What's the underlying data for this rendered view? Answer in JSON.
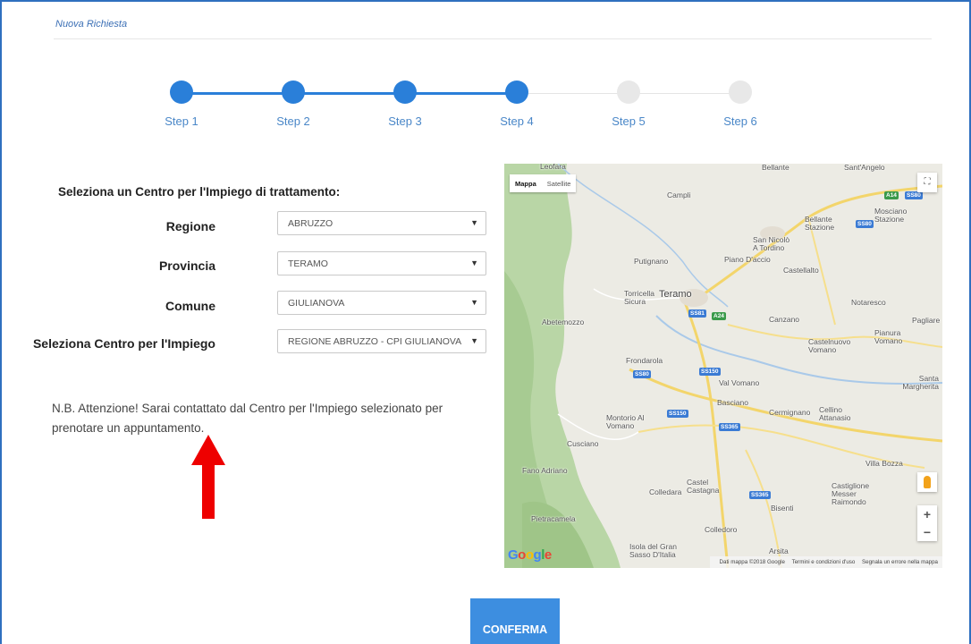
{
  "breadcrumb": "Nuova Richiesta",
  "stepper": {
    "steps": [
      {
        "label": "Step 1",
        "state": "completed"
      },
      {
        "label": "Step 2",
        "state": "completed"
      },
      {
        "label": "Step 3",
        "state": "completed"
      },
      {
        "label": "Step 4",
        "state": "current"
      },
      {
        "label": "Step 5",
        "state": "pending"
      },
      {
        "label": "Step 6",
        "state": "pending"
      }
    ],
    "colors": {
      "active": "#2a7fd9",
      "inactive": "#e8e8e8"
    }
  },
  "form": {
    "title": "Seleziona un Centro per l'Impiego di trattamento:",
    "fields": [
      {
        "label": "Regione",
        "value": "ABRUZZO"
      },
      {
        "label": "Provincia",
        "value": "TERAMO"
      },
      {
        "label": "Comune",
        "value": "GIULIANOVA"
      },
      {
        "label": "Seleziona Centro per l'Impiego",
        "value": "REGIONE ABRUZZO - CPI GIULIANOVA"
      }
    ]
  },
  "note": "N.B. Attenzione! Sarai contattato dal Centro per l'Impiego selezionato per prenotare un appuntamento.",
  "map": {
    "type_control": {
      "map": "Mappa",
      "satellite": "Satellite",
      "selected": "Mappa"
    },
    "places": [
      "Leofara",
      "Bellante",
      "Sant'Angelo",
      "Campli",
      "Bellante Stazione",
      "Mosciano Stazione",
      "San Nicolò A Tordino",
      "Putignano",
      "Piano D'accio",
      "Castellalto",
      "Torricella Sicura",
      "Teramo",
      "Notaresco",
      "Abetemozzo",
      "Canzano",
      "Pianura Vomano",
      "Pagliare",
      "Castelnuovo Vomano",
      "Frondarola",
      "Val Vomano",
      "Santa Margherita",
      "Basciano",
      "Cermignano",
      "Cellino Attanasio",
      "Montorio Al Vomano",
      "Cusciano",
      "Fano Adriano",
      "Villa Bozza",
      "Castel Castagna",
      "Colledara",
      "Castiglione Messer Raimondo",
      "Bisenti",
      "Pietracamela",
      "Colledoro",
      "Isola del Gran Sasso D'Italia",
      "Arsita"
    ],
    "road_shields": [
      "A14",
      "SS80",
      "SS80",
      "SS81",
      "A24",
      "SS80",
      "SS150",
      "SS150",
      "SS365",
      "SS365"
    ],
    "attribution": {
      "data": "Dati mappa ©2018 Google",
      "terms": "Termini e condizioni d'uso",
      "report": "Segnala un errore nella mappa"
    },
    "logo": "Google"
  },
  "confirm_label": "CONFERMA"
}
